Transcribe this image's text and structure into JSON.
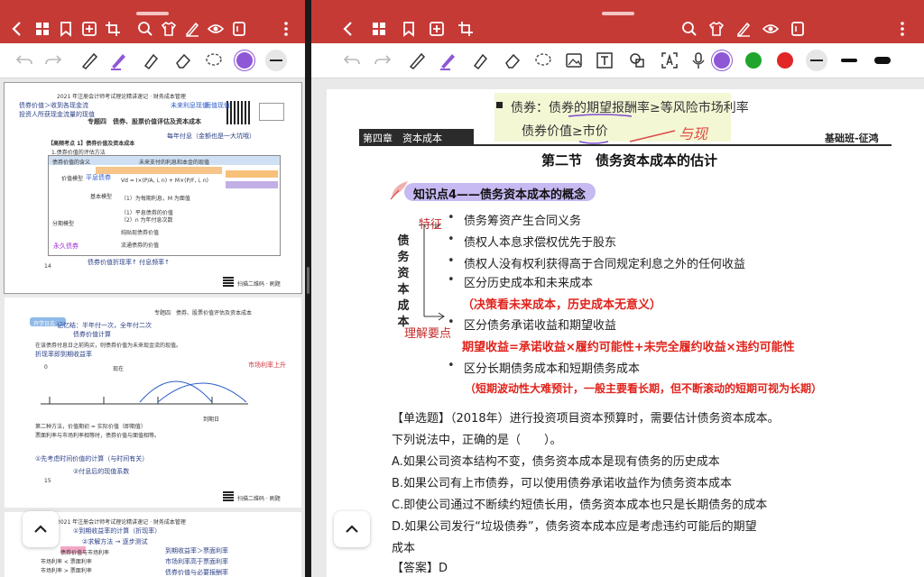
{
  "left_pane": {
    "thumb1": {
      "header": "2021 年注册会计师考试理论精讲速记 · 财务成本管理",
      "title": "专题四　债券、股票价值评估及资本成本",
      "section": "【高频考点 1】债券价值及资本成本",
      "sub1": "1.债券价值的评估方法",
      "col1": "债券价值的含义",
      "col2": "未来支付的利息和本金的现值",
      "row1": "价值模型",
      "row2": "基本模型",
      "row3": "分期模型",
      "line1": "Vd = I×(P/A, i, n) + M×(P/F, i, n)",
      "line2": "（1）为每期利息，M 为面值",
      "line3": "（1）平息债券的价值",
      "line4": "（2）n 为年付息次数",
      "line5": "纯贴现债券价值",
      "line6": "流通债券的价值",
      "hw1": "债券价值＞收到各现金流",
      "hw2": "投资人所获现金流量的现值",
      "hw3": "未来利息现值",
      "hw4": "面值现值",
      "hw5": "每年付息（金额也是一大坑哦）",
      "hw6": "平息债券",
      "hw7": "永久债券",
      "hw8": "债券价值折现率↑ 付息频率↑",
      "footer": "扫描二维码 · 刷题",
      "pgnum": "14"
    },
    "thumb2": {
      "header": "专题四　债券、股票价值评估及资本成本",
      "note": "开学日志",
      "hw1": "记忆结：半年付一次，全年付二次",
      "hw2": "债券价值计算",
      "hw3": "折现率即到期收益率",
      "hw4": "市场利率上升",
      "text1": "在该债券付息日之前购买，则债券价值为未来现金流的现值。",
      "text2": "0",
      "text3": "到期日",
      "text4": "现在",
      "bottom1": "第二种方法，价值期初 = 实际价值（即期值）",
      "bottom2": "票面利率与市场利率相等时，债券价值与面值相等。",
      "hw5": "①先考虑时间价值的计算（与时间有关）",
      "hw6": "②付息后的现值系数",
      "footer": "扫描二维码 · 刷题",
      "pgnum": "15"
    },
    "thumb3": {
      "header": "2021 年注册会计师考试理论精讲速记 · 财务成本管理",
      "hw1": "①到期收益率的计算（折现率）",
      "hw2": "②求解方法 → 逐步测试",
      "hw3": "到期收益率＞票面利率",
      "hw4": "市场利率高于票面利率",
      "text1": "债券价值与市场利率",
      "text2": "市场利率 < 票面利率",
      "text3": "市场利率 > 票面利率",
      "hw5": "债券价值与必要报酬率"
    }
  },
  "right_page": {
    "hl_line1": "债券：债券的期望报酬率≥等风险市场利率",
    "hl_line2": "债券价值≥市价",
    "hl_hw": "与现",
    "chapter": "第四章　资本成本",
    "header_right": "基础班-征鸿",
    "section_title": "第二节　债务资本成本的估计",
    "kp_title": "知识点4——债务资本成本的概念",
    "label_feature": "特征",
    "vertical": [
      "债",
      "务",
      "资",
      "本",
      "成",
      "本"
    ],
    "label_key": "理解要点",
    "bullets": [
      "债务筹资产生合同义务",
      "债权人本息求偿权优先于股东",
      "债权人没有权利获得高于合同规定利息之外的任何收益",
      "区分历史成本和未来成本",
      "区分债务承诺收益和期望收益",
      "区分长期债务成本和短期债务成本"
    ],
    "note1": "（决策看未来成本，历史成本无意义）",
    "note2": "期望收益=承诺收益×履约可能性+未完全履约收益×违约可能性",
    "note3": "（短期波动性大难预计，一般主要看长期，但不断滚动的短期可视为长期）",
    "question_line1": "【单选题】（2018年）进行投资项目资本预算时，需要估计债务资本成本。",
    "question_line2": "下列说法中，正确的是（　　）。",
    "option_a": "A.如果公司资本结构不变，债务资本成本是现有债务的历史成本",
    "option_b": "B.如果公司有上市债券，可以使用债券承诺收益作为债务资本成本",
    "option_c": "C.即使公司通过不断续约短债长用，债务资本成本也只是长期债务的成本",
    "option_d": "D.如果公司发行“垃圾债券”，债务资本成本应是考虑违约可能后的期望",
    "option_d2": "成本",
    "answer": "【答案】D"
  },
  "colors": {
    "app_bar": "#c63a36",
    "pen_purple": "#8e57d6",
    "green": "#1fa52b",
    "red": "#e02626",
    "kp_purple": "#7b4fd0",
    "note_red": "#e0231c",
    "bullet_label_red": "#c42a2a"
  }
}
